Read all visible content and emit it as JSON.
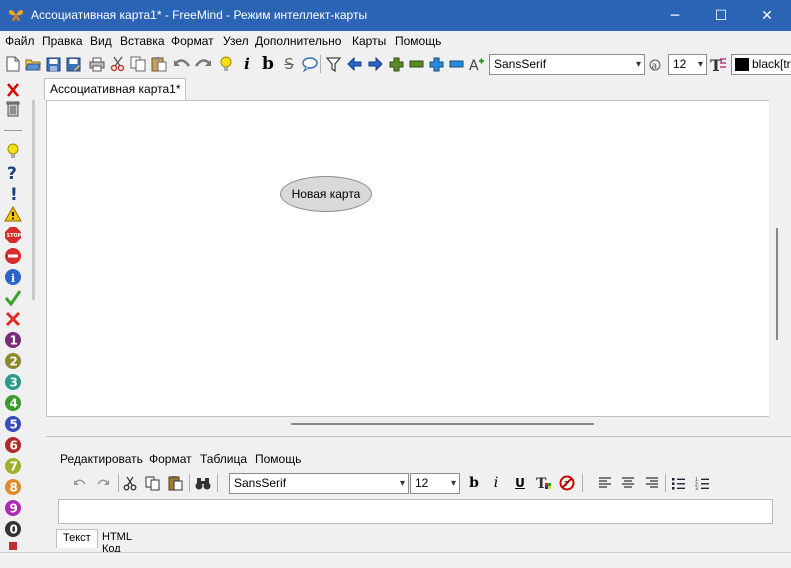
{
  "window": {
    "title": "Ассоциативная карта1* - FreeMind - Режим интеллект-карты",
    "minimize_label": "─",
    "maximize_label": "☐",
    "close_label": "✕"
  },
  "menu": [
    "Файл",
    "Правка",
    "Вид",
    "Вставка",
    "Формат",
    "Узел",
    "Дополнительно",
    "Карты",
    "Помощь"
  ],
  "toolbar": {
    "font_family": "SansSerif",
    "font_size": "12",
    "color_value": "black[tr"
  },
  "tabs": {
    "map_tab": "Ассоциативная карта1*"
  },
  "map": {
    "root_node": "Новая карта"
  },
  "note_editor": {
    "menu": [
      "Редактировать",
      "Формат",
      "Таблица",
      "Помощь"
    ],
    "font_family": "SansSerif",
    "font_size": "12",
    "tabs": [
      "Текст",
      "HTML Код"
    ]
  },
  "colors": {
    "titlebar": "#2b64b5",
    "node_fill": "#d9d9d9"
  }
}
